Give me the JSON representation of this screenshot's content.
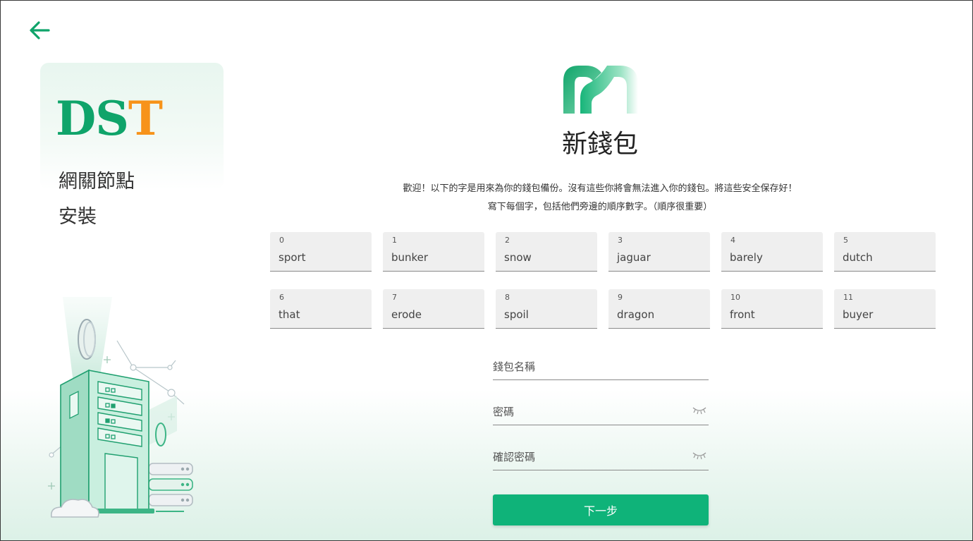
{
  "sidebar": {
    "brand_part1": "DS",
    "brand_part2": "T",
    "line1": "網關節點",
    "line2": "安裝"
  },
  "main": {
    "title": "新錢包",
    "intro_line1": "歡迎！以下的字是用來為你的錢包備份。沒有這些你將會無法進入你的錢包。將這些安全保存好！",
    "intro_line2": "寫下每個字，包括他們旁邊的順序數字。（順序很重要）"
  },
  "seed_words": [
    {
      "index": "0",
      "word": "sport"
    },
    {
      "index": "1",
      "word": "bunker"
    },
    {
      "index": "2",
      "word": "snow"
    },
    {
      "index": "3",
      "word": "jaguar"
    },
    {
      "index": "4",
      "word": "barely"
    },
    {
      "index": "5",
      "word": "dutch"
    },
    {
      "index": "6",
      "word": "that"
    },
    {
      "index": "7",
      "word": "erode"
    },
    {
      "index": "8",
      "word": "spoil"
    },
    {
      "index": "9",
      "word": "dragon"
    },
    {
      "index": "10",
      "word": "front"
    },
    {
      "index": "11",
      "word": "buyer"
    }
  ],
  "form": {
    "wallet_name_label": "錢包名稱",
    "password_label": "密碼",
    "confirm_password_label": "確認密碼",
    "next_button": "下一步"
  },
  "colors": {
    "accent_green": "#0fb379",
    "brand_green": "#0fa46a",
    "brand_orange": "#f7931a"
  },
  "icons": {
    "back": "arrow-left-icon",
    "eye": "eye-closed-icon"
  }
}
